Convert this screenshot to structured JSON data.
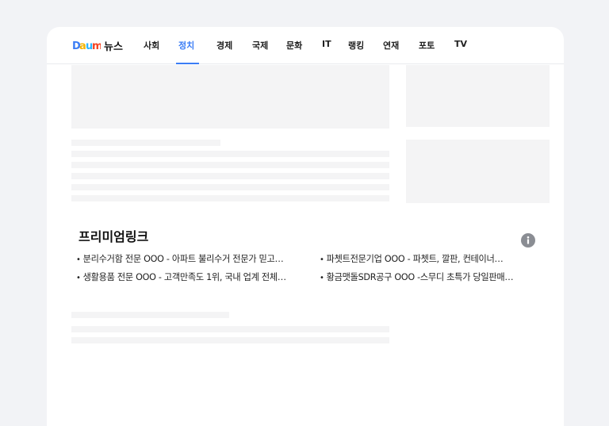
{
  "header": {
    "logo_text": "Daum",
    "section_title": "뉴스",
    "tabs": [
      {
        "label": "사회"
      },
      {
        "label": "정치",
        "active": true
      },
      {
        "label": "경제"
      },
      {
        "label": "국제"
      },
      {
        "label": "문화"
      },
      {
        "label": "IT"
      },
      {
        "label": "랭킹"
      },
      {
        "label": "연재"
      },
      {
        "label": "포토"
      },
      {
        "label": "TV"
      }
    ]
  },
  "premium": {
    "title": "프리미엄링크",
    "bullet": "•",
    "links": [
      "분리수거함 전문 OOO - 아파트 불리수거 전문가 믿고…",
      "파쳇트전문기업 OOO - 파쳇트, 깔판, 컨테이너…",
      "생활용품 전문 OOO - 고객만족도 1위, 국내 업계 전체…",
      "황금맷돌SDR공구 OOO -스무디 초특가 당일판매…"
    ]
  },
  "colors": {
    "accent": "#3b7df5",
    "background": "#f2f3f6",
    "skeleton": "#f4f4f5",
    "info_icon": "#8a8d93"
  },
  "icons": {
    "info": "info-circle-icon"
  }
}
